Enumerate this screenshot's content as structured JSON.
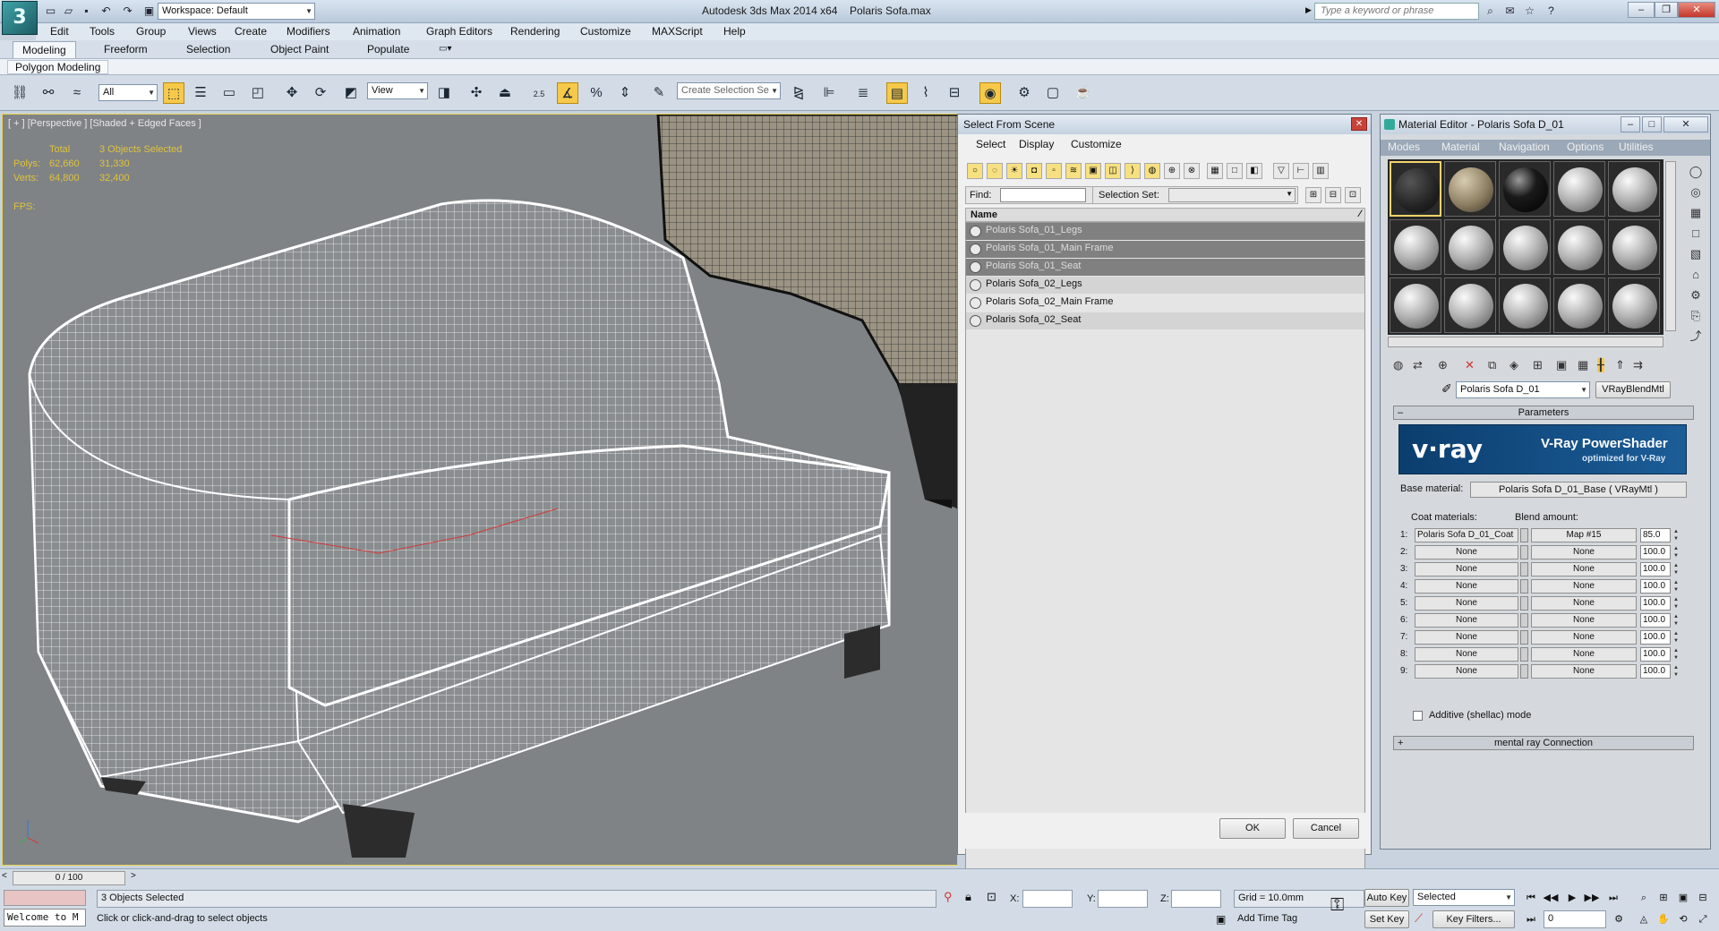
{
  "app": {
    "title": "Autodesk 3ds Max  2014 x64",
    "file": "Polaris Sofa.max",
    "workspace": "Workspace: Default",
    "search_placeholder": "Type a keyword or phrase"
  },
  "menus": [
    "Edit",
    "Tools",
    "Group",
    "Views",
    "Create",
    "Modifiers",
    "Animation",
    "Graph Editors",
    "Rendering",
    "Customize",
    "MAXScript",
    "Help"
  ],
  "ribbon": {
    "tabs": [
      "Modeling",
      "Freeform",
      "Selection",
      "Object Paint",
      "Populate"
    ],
    "active_tab": "Modeling",
    "panel": "Polygon Modeling"
  },
  "toolbar": {
    "filter": "All",
    "coord": "View",
    "selection_set": "Create Selection Se",
    "snap_labels": [
      "2.5",
      "%"
    ]
  },
  "viewport": {
    "label": "[ + ] [Perspective ] [Shaded + Edged Faces ]",
    "stats": {
      "total_label": "Total",
      "sel_label": "3 Objects Selected",
      "polys_label": "Polys:",
      "polys_total": "62,660",
      "polys_sel": "31,330",
      "verts_label": "Verts:",
      "verts_total": "64,800",
      "verts_sel": "32,400",
      "fps_label": "FPS:"
    },
    "wire_color": "#ffffff",
    "bg_color": "#7f8386"
  },
  "select_dialog": {
    "title": "Select From Scene",
    "menus": [
      "Select",
      "Display",
      "Customize"
    ],
    "find_label": "Find:",
    "selset_label": "Selection Set:",
    "column": "Name",
    "items": [
      {
        "name": "Polaris Sofa_01_Legs",
        "selected": true
      },
      {
        "name": "Polaris Sofa_01_Main Frame",
        "selected": true
      },
      {
        "name": "Polaris Sofa_01_Seat",
        "selected": true
      },
      {
        "name": "Polaris Sofa_02_Legs",
        "selected": false
      },
      {
        "name": "Polaris Sofa_02_Main Frame",
        "selected": false
      },
      {
        "name": "Polaris Sofa_02_Seat",
        "selected": false
      }
    ],
    "ok": "OK",
    "cancel": "Cancel"
  },
  "material_editor": {
    "title": "Material Editor - Polaris Sofa D_01",
    "menus": [
      "Modes",
      "Material",
      "Navigation",
      "Options",
      "Utilities"
    ],
    "material_name": "Polaris Sofa D_01",
    "material_type": "VRayBlendMtl",
    "rollout_params": "Parameters",
    "vray_logo": "v·ray",
    "vray_title": "V-Ray PowerShader",
    "vray_sub": "optimized for V-Ray",
    "base_label": "Base material:",
    "base_value": "Polaris Sofa D_01_Base  ( VRayMtl )",
    "coat_label": "Coat materials:",
    "blend_label": "Blend amount:",
    "coats": [
      {
        "n": "1:",
        "mat": "Polaris Sofa D_01_Coat",
        "map": "Map #15",
        "amt": "85.0"
      },
      {
        "n": "2:",
        "mat": "None",
        "map": "None",
        "amt": "100.0"
      },
      {
        "n": "3:",
        "mat": "None",
        "map": "None",
        "amt": "100.0"
      },
      {
        "n": "4:",
        "mat": "None",
        "map": "None",
        "amt": "100.0"
      },
      {
        "n": "5:",
        "mat": "None",
        "map": "None",
        "amt": "100.0"
      },
      {
        "n": "6:",
        "mat": "None",
        "map": "None",
        "amt": "100.0"
      },
      {
        "n": "7:",
        "mat": "None",
        "map": "None",
        "amt": "100.0"
      },
      {
        "n": "8:",
        "mat": "None",
        "map": "None",
        "amt": "100.0"
      },
      {
        "n": "9:",
        "mat": "None",
        "map": "None",
        "amt": "100.0"
      }
    ],
    "additive_label": "Additive (shellac) mode",
    "mr_rollout": "mental ray Connection"
  },
  "status": {
    "timeline": "0 / 100",
    "selected_count": "3 Objects Selected",
    "prompt": "Click or click-and-drag to select objects",
    "welcome": "Welcome to M",
    "x_label": "X:",
    "y_label": "Y:",
    "z_label": "Z:",
    "grid": "Grid = 10.0mm",
    "add_time_tag": "Add Time Tag",
    "auto_key": "Auto Key",
    "set_key": "Set Key",
    "key_mode": "Selected",
    "key_filters": "Key Filters...",
    "frame": "0"
  }
}
